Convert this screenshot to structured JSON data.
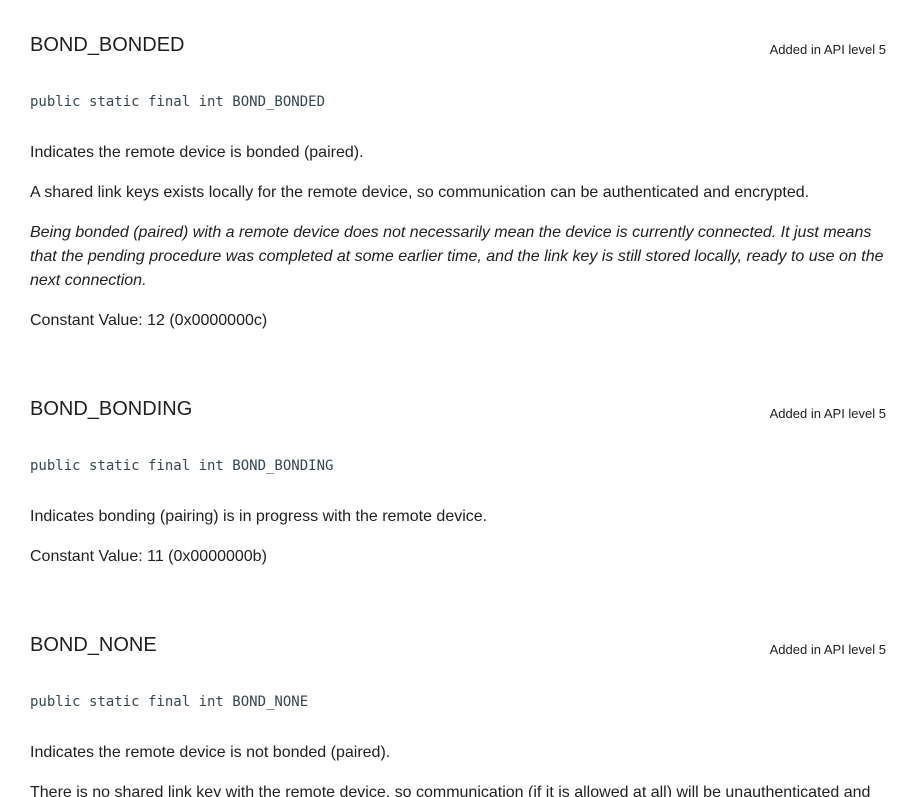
{
  "sections": [
    {
      "title": "BOND_BONDED",
      "api_level": "Added in API level 5",
      "signature": "public static final int BOND_BONDED",
      "paragraphs": [
        "Indicates the remote device is bonded (paired).",
        "A shared link keys exists locally for the remote device, so communication can be authenticated and encrypted."
      ],
      "italic_note": "Being bonded (paired) with a remote device does not necessarily mean the device is currently connected. It just means that the pending procedure was completed at some earlier time, and the link key is still stored locally, ready to use on the next connection.",
      "constant_value": "Constant Value: 12 (0x0000000c)"
    },
    {
      "title": "BOND_BONDING",
      "api_level": "Added in API level 5",
      "signature": "public static final int BOND_BONDING",
      "paragraphs": [
        "Indicates bonding (pairing) is in progress with the remote device."
      ],
      "constant_value": "Constant Value: 11 (0x0000000b)"
    },
    {
      "title": "BOND_NONE",
      "api_level": "Added in API level 5",
      "signature": "public static final int BOND_NONE",
      "paragraphs": [
        "Indicates the remote device is not bonded (paired).",
        "There is no shared link key with the remote device, so communication (if it is allowed at all) will be unauthenticated and"
      ]
    }
  ]
}
